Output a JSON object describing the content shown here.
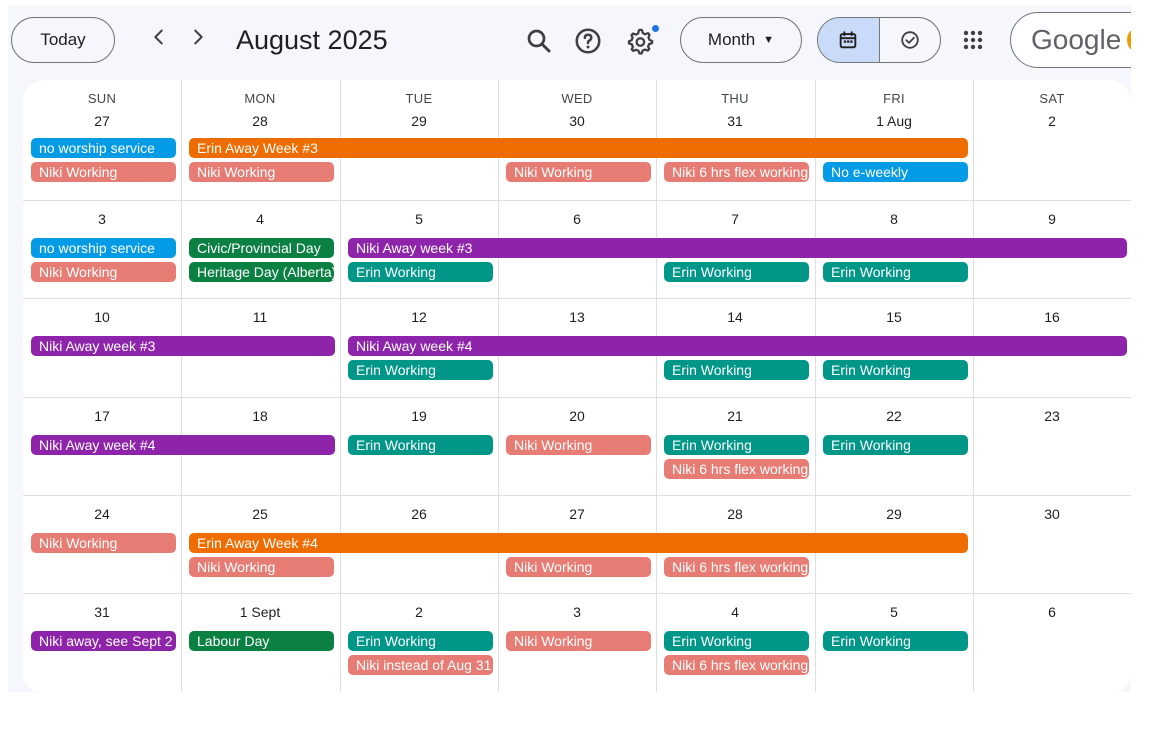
{
  "toolbar": {
    "today_label": "Today",
    "prev_icon": "chevron-left-icon",
    "next_icon": "chevron-right-icon",
    "title": "August 2025",
    "view_label": "Month",
    "brand_text": "Google"
  },
  "icons": {
    "search": "search-icon",
    "help": "help-icon",
    "settings": "gear-icon",
    "calendar_view": "calendar-icon",
    "tasks_view": "task-check-icon",
    "apps": "apps-grid-icon"
  },
  "colors": {
    "blue": "#039be5",
    "orange": "#ef6c00",
    "salmon": "#e67c73",
    "purple": "#8e24aa",
    "teal": "#009688",
    "green": "#0b8043",
    "accent": "#1a73e8"
  },
  "weekdays": [
    "SUN",
    "MON",
    "TUE",
    "WED",
    "THU",
    "FRI",
    "SAT"
  ],
  "weeks": [
    {
      "days": [
        "27",
        "28",
        "29",
        "30",
        "31",
        "1 Aug",
        "2"
      ],
      "events": [
        {
          "title": "no worship service",
          "start": 0,
          "span": 1,
          "lane": 0,
          "color": "blue"
        },
        {
          "title": "Erin Away Week #3",
          "start": 1,
          "span": 5,
          "lane": 0,
          "color": "orange"
        },
        {
          "title": "Niki Working",
          "start": 0,
          "span": 1,
          "lane": 1,
          "color": "salmon"
        },
        {
          "title": "Niki Working",
          "start": 1,
          "span": 1,
          "lane": 1,
          "color": "salmon"
        },
        {
          "title": "Niki Working",
          "start": 3,
          "span": 1,
          "lane": 1,
          "color": "salmon"
        },
        {
          "title": "Niki 6 hrs flex working",
          "start": 4,
          "span": 1,
          "lane": 1,
          "color": "salmon"
        },
        {
          "title": "No e-weekly",
          "start": 5,
          "span": 1,
          "lane": 1,
          "color": "blue"
        }
      ]
    },
    {
      "days": [
        "3",
        "4",
        "5",
        "6",
        "7",
        "8",
        "9"
      ],
      "events": [
        {
          "title": "no worship service",
          "start": 0,
          "span": 1,
          "lane": 0,
          "color": "blue"
        },
        {
          "title": "Civic/Provincial Day",
          "start": 1,
          "span": 1,
          "lane": 0,
          "color": "green"
        },
        {
          "title": "Niki Away week #3",
          "start": 2,
          "span": 5,
          "lane": 0,
          "color": "purple"
        },
        {
          "title": "Niki Working",
          "start": 0,
          "span": 1,
          "lane": 1,
          "color": "salmon"
        },
        {
          "title": "Heritage Day (Alberta)",
          "start": 1,
          "span": 1,
          "lane": 1,
          "color": "green"
        },
        {
          "title": "Erin Working",
          "start": 2,
          "span": 1,
          "lane": 1,
          "color": "teal"
        },
        {
          "title": "Erin Working",
          "start": 4,
          "span": 1,
          "lane": 1,
          "color": "teal"
        },
        {
          "title": "Erin Working",
          "start": 5,
          "span": 1,
          "lane": 1,
          "color": "teal"
        }
      ]
    },
    {
      "days": [
        "10",
        "11",
        "12",
        "13",
        "14",
        "15",
        "16"
      ],
      "events": [
        {
          "title": "Niki Away week #3",
          "start": 0,
          "span": 2,
          "lane": 0,
          "color": "purple"
        },
        {
          "title": "Niki Away week #4",
          "start": 2,
          "span": 5,
          "lane": 0,
          "color": "purple"
        },
        {
          "title": "Erin Working",
          "start": 2,
          "span": 1,
          "lane": 1,
          "color": "teal"
        },
        {
          "title": "Erin Working",
          "start": 4,
          "span": 1,
          "lane": 1,
          "color": "teal"
        },
        {
          "title": "Erin Working",
          "start": 5,
          "span": 1,
          "lane": 1,
          "color": "teal"
        }
      ]
    },
    {
      "days": [
        "17",
        "18",
        "19",
        "20",
        "21",
        "22",
        "23"
      ],
      "events": [
        {
          "title": "Niki Away week #4",
          "start": 0,
          "span": 2,
          "lane": 0,
          "color": "purple"
        },
        {
          "title": "Erin Working",
          "start": 2,
          "span": 1,
          "lane": 0,
          "color": "teal"
        },
        {
          "title": "Niki Working",
          "start": 3,
          "span": 1,
          "lane": 0,
          "color": "salmon"
        },
        {
          "title": "Erin Working",
          "start": 4,
          "span": 1,
          "lane": 0,
          "color": "teal"
        },
        {
          "title": "Erin Working",
          "start": 5,
          "span": 1,
          "lane": 0,
          "color": "teal"
        },
        {
          "title": "Niki 6 hrs flex working",
          "start": 4,
          "span": 1,
          "lane": 1,
          "color": "salmon"
        }
      ]
    },
    {
      "days": [
        "24",
        "25",
        "26",
        "27",
        "28",
        "29",
        "30"
      ],
      "events": [
        {
          "title": "Niki Working",
          "start": 0,
          "span": 1,
          "lane": 0,
          "color": "salmon"
        },
        {
          "title": "Erin Away Week #4",
          "start": 1,
          "span": 5,
          "lane": 0,
          "color": "orange"
        },
        {
          "title": "Niki Working",
          "start": 1,
          "span": 1,
          "lane": 1,
          "color": "salmon"
        },
        {
          "title": "Niki Working",
          "start": 3,
          "span": 1,
          "lane": 1,
          "color": "salmon"
        },
        {
          "title": "Niki 6 hrs flex working",
          "start": 4,
          "span": 1,
          "lane": 1,
          "color": "salmon"
        }
      ]
    },
    {
      "days": [
        "31",
        "1 Sept",
        "2",
        "3",
        "4",
        "5",
        "6"
      ],
      "events": [
        {
          "title": "Niki away, see Sept 2",
          "start": 0,
          "span": 1,
          "lane": 0,
          "color": "purple"
        },
        {
          "title": "Labour Day",
          "start": 1,
          "span": 1,
          "lane": 0,
          "color": "green"
        },
        {
          "title": "Erin Working",
          "start": 2,
          "span": 1,
          "lane": 0,
          "color": "teal"
        },
        {
          "title": "Niki Working",
          "start": 3,
          "span": 1,
          "lane": 0,
          "color": "salmon"
        },
        {
          "title": "Erin Working",
          "start": 4,
          "span": 1,
          "lane": 0,
          "color": "teal"
        },
        {
          "title": "Erin Working",
          "start": 5,
          "span": 1,
          "lane": 0,
          "color": "teal"
        },
        {
          "title": "Niki instead of Aug 31",
          "start": 2,
          "span": 1,
          "lane": 1,
          "color": "salmon"
        },
        {
          "title": "Niki 6 hrs flex working",
          "start": 4,
          "span": 1,
          "lane": 1,
          "color": "salmon"
        }
      ]
    }
  ]
}
